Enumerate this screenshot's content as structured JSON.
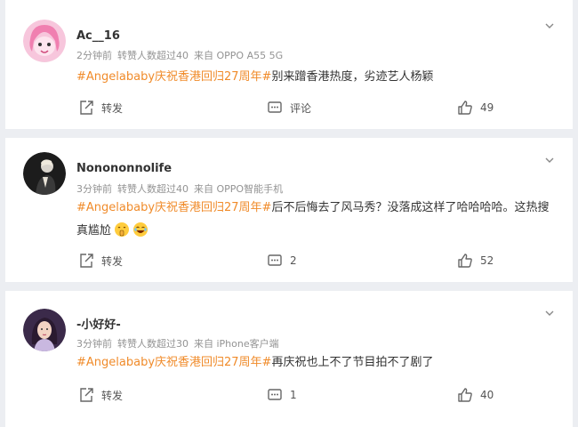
{
  "comments": [
    {
      "username": "Ac__16",
      "time": "2分钟前",
      "reposts": "转赞人数超过40",
      "source": "来自 OPPO A55 5G",
      "hashtag": "#Angelababy庆祝香港回归27周年#",
      "text": "别来蹭香港热度，劣迹艺人杨颖",
      "share_label": "转发",
      "comment_label": "评论",
      "likes": "49"
    },
    {
      "username": "Nonononnolife",
      "time": "3分钟前",
      "reposts": "转赞人数超过40",
      "source": "来自 OPPO智能手机",
      "hashtag": "#Angelababy庆祝香港回归27周年#",
      "text": "后不后悔去了风马秀？没落成这样了哈哈哈哈。这热搜真尴尬",
      "share_label": "转发",
      "comment_label": "2",
      "likes": "52"
    },
    {
      "username": "-小好好-",
      "time": "3分钟前",
      "reposts": "转赞人数超过30",
      "source": "来自 iPhone客户端",
      "hashtag": "#Angelababy庆祝香港回归27周年#",
      "text": "再庆祝也上不了节目拍不了剧了",
      "share_label": "转发",
      "comment_label": "1",
      "likes": "40"
    }
  ],
  "colors": {
    "hashtag": "#f08b2a",
    "background": "#eceef2",
    "meta": "#939393"
  },
  "icons": {
    "share": "share-icon",
    "comment": "comment-icon",
    "like": "thumbs-up-icon",
    "menu": "chevron-down-icon"
  }
}
